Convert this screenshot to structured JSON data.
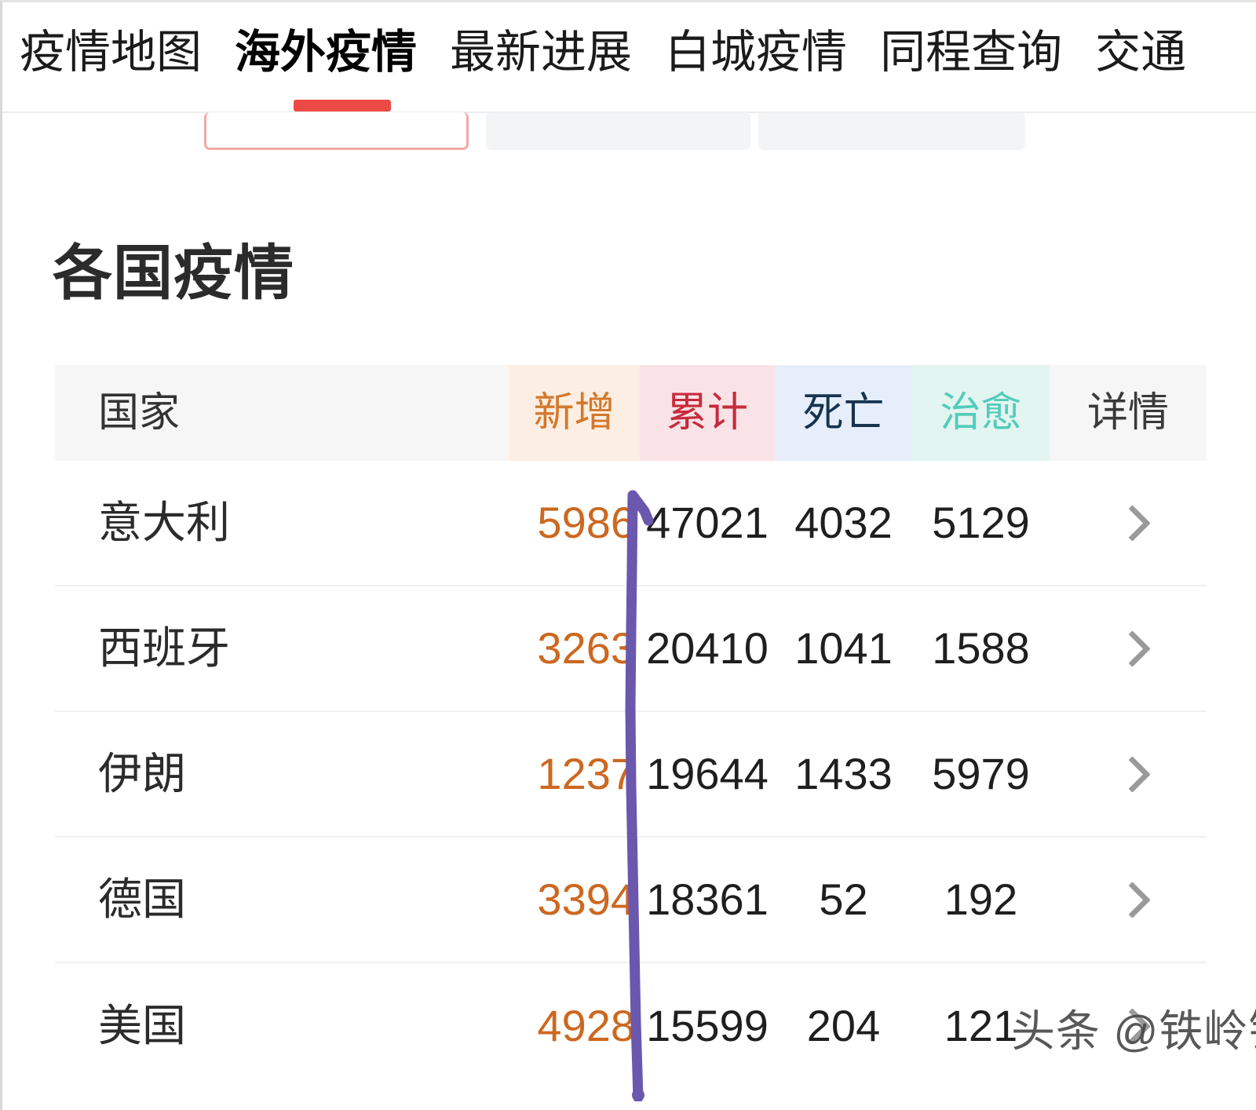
{
  "nav": {
    "tabs": [
      {
        "label": "疫情地图",
        "active": false
      },
      {
        "label": "海外疫情",
        "active": true
      },
      {
        "label": "最新进展",
        "active": false
      },
      {
        "label": "白城疫情",
        "active": false
      },
      {
        "label": "同程查询",
        "active": false
      },
      {
        "label": "交通",
        "active": false
      }
    ],
    "active_index": 1,
    "underline_color": "#ee4a45"
  },
  "cards": {
    "selected_border_color": "#f0a9a6",
    "placeholder_bg": "#f3f4f5",
    "count": 3
  },
  "section": {
    "title": "各国疫情"
  },
  "table": {
    "header_bg": "#f6f6f6",
    "columns": [
      {
        "key": "country",
        "label": "国家",
        "bg": "#f6f6f6",
        "color": "#333333"
      },
      {
        "key": "new",
        "label": "新增",
        "bg": "#fceee2",
        "color": "#d3782c"
      },
      {
        "key": "total",
        "label": "累计",
        "bg": "#f9e3e6",
        "color": "#c72a3c"
      },
      {
        "key": "death",
        "label": "死亡",
        "bg": "#e6eefb",
        "color": "#17334e"
      },
      {
        "key": "cured",
        "label": "治愈",
        "bg": "#e3f5f0",
        "color": "#54ccbc"
      },
      {
        "key": "detail",
        "label": "详情",
        "bg": "#f6f6f6",
        "color": "#3a3a3a"
      }
    ],
    "rows": [
      {
        "country": "意大利",
        "new": "5986",
        "total": "47021",
        "death": "4032",
        "cured": "5129",
        "detail_icon": "chevron-right-icon"
      },
      {
        "country": "西班牙",
        "new": "3263",
        "total": "20410",
        "death": "1041",
        "cured": "1588",
        "detail_icon": "chevron-right-icon"
      },
      {
        "country": "伊朗",
        "new": "1237",
        "total": "19644",
        "death": "1433",
        "cured": "5979",
        "detail_icon": "chevron-right-icon"
      },
      {
        "country": "德国",
        "new": "3394",
        "total": "18361",
        "death": "52",
        "cured": "192",
        "detail_icon": "chevron-right-icon"
      },
      {
        "country": "美国",
        "new": "4928",
        "total": "15599",
        "death": "204",
        "cured": "121",
        "detail_icon": "chevron-right-icon"
      }
    ]
  },
  "annotation": {
    "type": "hand-drawn-arrow",
    "color": "#6a57ae",
    "description": "竖直向上的手绘紫色箭头，沿新增与累计两列之间"
  },
  "watermark": {
    "text": "头条 @铁岭锋"
  }
}
